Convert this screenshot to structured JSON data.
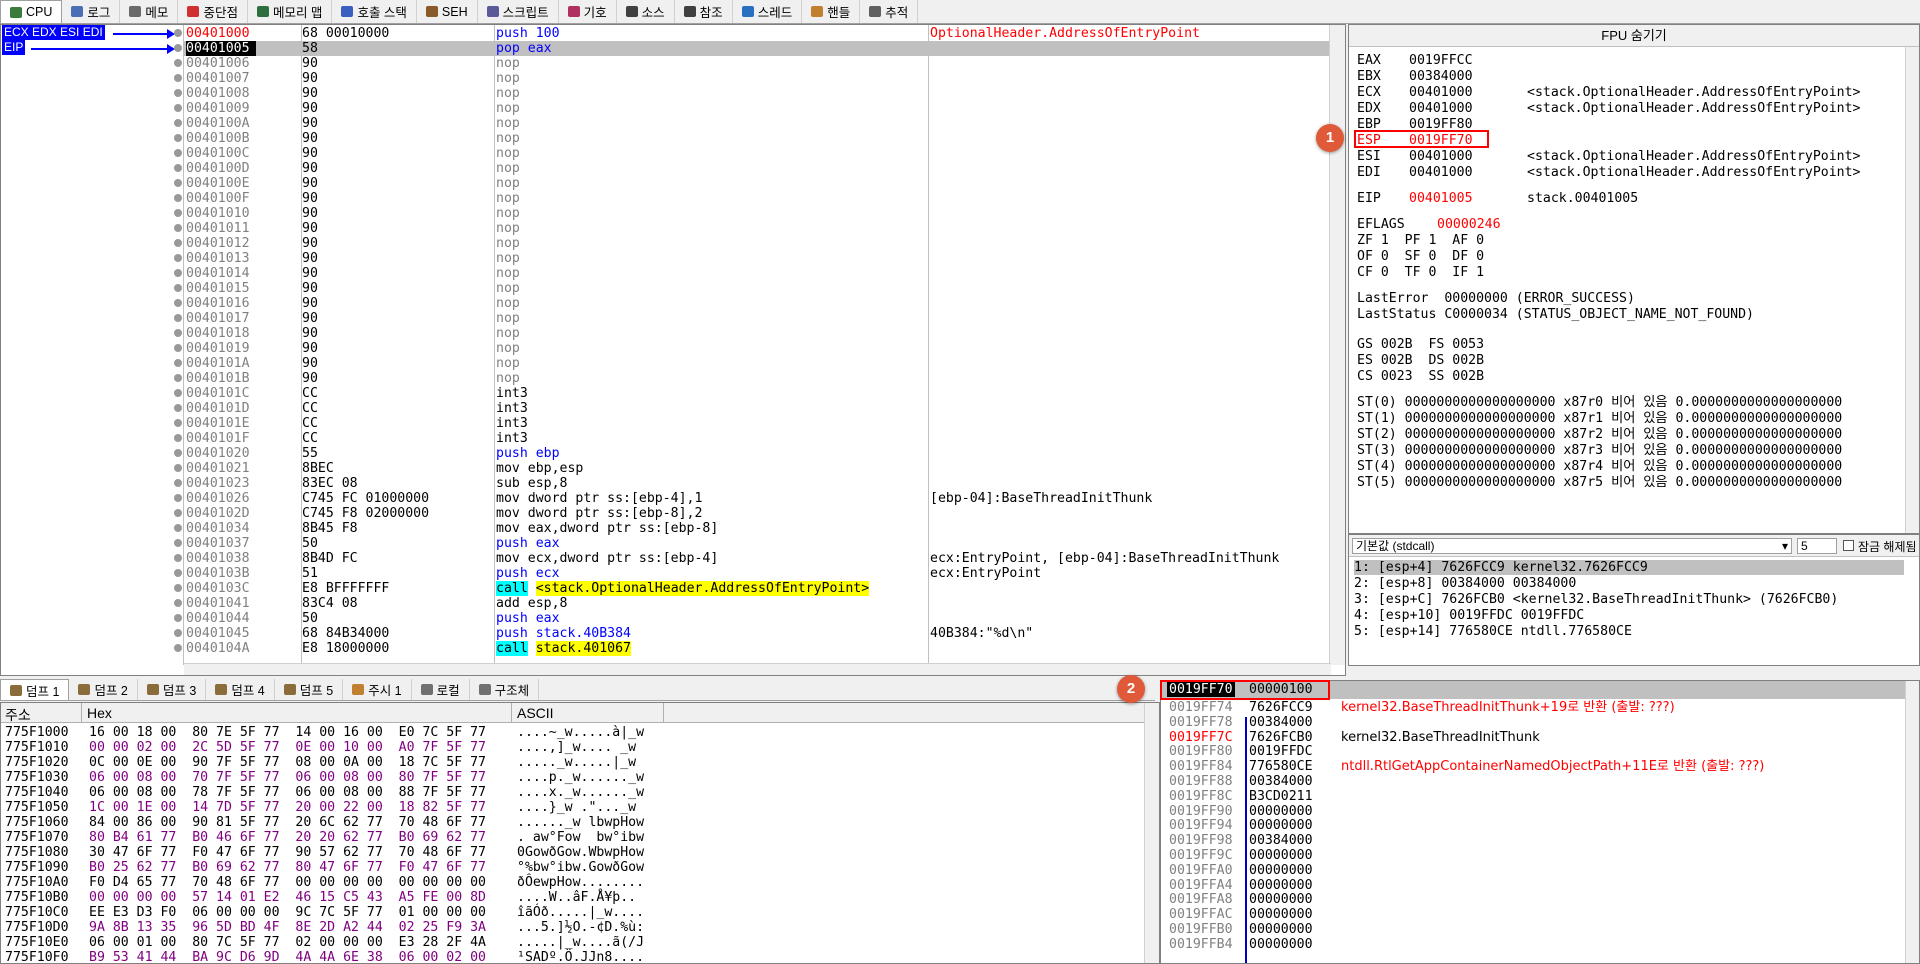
{
  "tabs": [
    {
      "label": "CPU",
      "icon": "cpu-icon",
      "color": "#3a7d3a"
    },
    {
      "label": "로그",
      "icon": "log-icon",
      "color": "#4a6fb5"
    },
    {
      "label": "메모",
      "icon": "note-icon",
      "color": "#6a6a6a"
    },
    {
      "label": "중단점",
      "icon": "breakpoint-icon",
      "color": "#d03030"
    },
    {
      "label": "메모리 맵",
      "icon": "memory-map-icon",
      "color": "#2f6f3f"
    },
    {
      "label": "호출 스택",
      "icon": "call-stack-icon",
      "color": "#3a5fbf"
    },
    {
      "label": "SEH",
      "icon": "seh-icon",
      "color": "#8a5a2a"
    },
    {
      "label": "스크립트",
      "icon": "script-icon",
      "color": "#5a5a9a"
    },
    {
      "label": "기호",
      "icon": "symbol-icon",
      "color": "#b03060"
    },
    {
      "label": "소스",
      "icon": "source-icon",
      "color": "#404040"
    },
    {
      "label": "참조",
      "icon": "reference-icon",
      "color": "#404040"
    },
    {
      "label": "스레드",
      "icon": "thread-icon",
      "color": "#2a70c0"
    },
    {
      "label": "핸들",
      "icon": "handle-icon",
      "color": "#c08030"
    },
    {
      "label": "추적",
      "icon": "trace-icon",
      "color": "#606060"
    }
  ],
  "disasm": {
    "reg_labels": [
      "ECX EDX ESI EDI",
      "EIP"
    ],
    "rows": [
      {
        "addr": "00401000",
        "bytes": "68 00010000",
        "asm": "push 100",
        "cmt": "OptionalHeader.AddressOfEntryPoint",
        "cls": "push",
        "addrred": true,
        "cmtred": true
      },
      {
        "addr": "00401005",
        "bytes": "58",
        "asm": "pop eax",
        "cmt": "",
        "cls": "push",
        "sel": true
      },
      {
        "addr": "00401006",
        "bytes": "90",
        "asm": "nop",
        "cmt": "",
        "cls": "nop"
      },
      {
        "addr": "00401007",
        "bytes": "90",
        "asm": "nop",
        "cmt": "",
        "cls": "nop"
      },
      {
        "addr": "00401008",
        "bytes": "90",
        "asm": "nop",
        "cmt": "",
        "cls": "nop"
      },
      {
        "addr": "00401009",
        "bytes": "90",
        "asm": "nop",
        "cmt": "",
        "cls": "nop"
      },
      {
        "addr": "0040100A",
        "bytes": "90",
        "asm": "nop",
        "cmt": "",
        "cls": "nop"
      },
      {
        "addr": "0040100B",
        "bytes": "90",
        "asm": "nop",
        "cmt": "",
        "cls": "nop"
      },
      {
        "addr": "0040100C",
        "bytes": "90",
        "asm": "nop",
        "cmt": "",
        "cls": "nop"
      },
      {
        "addr": "0040100D",
        "bytes": "90",
        "asm": "nop",
        "cmt": "",
        "cls": "nop"
      },
      {
        "addr": "0040100E",
        "bytes": "90",
        "asm": "nop",
        "cmt": "",
        "cls": "nop"
      },
      {
        "addr": "0040100F",
        "bytes": "90",
        "asm": "nop",
        "cmt": "",
        "cls": "nop"
      },
      {
        "addr": "00401010",
        "bytes": "90",
        "asm": "nop",
        "cmt": "",
        "cls": "nop"
      },
      {
        "addr": "00401011",
        "bytes": "90",
        "asm": "nop",
        "cmt": "",
        "cls": "nop"
      },
      {
        "addr": "00401012",
        "bytes": "90",
        "asm": "nop",
        "cmt": "",
        "cls": "nop"
      },
      {
        "addr": "00401013",
        "bytes": "90",
        "asm": "nop",
        "cmt": "",
        "cls": "nop"
      },
      {
        "addr": "00401014",
        "bytes": "90",
        "asm": "nop",
        "cmt": "",
        "cls": "nop"
      },
      {
        "addr": "00401015",
        "bytes": "90",
        "asm": "nop",
        "cmt": "",
        "cls": "nop"
      },
      {
        "addr": "00401016",
        "bytes": "90",
        "asm": "nop",
        "cmt": "",
        "cls": "nop"
      },
      {
        "addr": "00401017",
        "bytes": "90",
        "asm": "nop",
        "cmt": "",
        "cls": "nop"
      },
      {
        "addr": "00401018",
        "bytes": "90",
        "asm": "nop",
        "cmt": "",
        "cls": "nop"
      },
      {
        "addr": "00401019",
        "bytes": "90",
        "asm": "nop",
        "cmt": "",
        "cls": "nop"
      },
      {
        "addr": "0040101A",
        "bytes": "90",
        "asm": "nop",
        "cmt": "",
        "cls": "nop"
      },
      {
        "addr": "0040101B",
        "bytes": "90",
        "asm": "nop",
        "cmt": "",
        "cls": "nop"
      },
      {
        "addr": "0040101C",
        "bytes": "CC",
        "asm": "int3",
        "cmt": "",
        "cls": "int"
      },
      {
        "addr": "0040101D",
        "bytes": "CC",
        "asm": "int3",
        "cmt": "",
        "cls": "int"
      },
      {
        "addr": "0040101E",
        "bytes": "CC",
        "asm": "int3",
        "cmt": "",
        "cls": "int"
      },
      {
        "addr": "0040101F",
        "bytes": "CC",
        "asm": "int3",
        "cmt": "",
        "cls": "int"
      },
      {
        "addr": "00401020",
        "bytes": "55",
        "asm": "push ebp",
        "cmt": "",
        "cls": "push"
      },
      {
        "addr": "00401021",
        "bytes": "8BEC",
        "asm": "mov ebp,esp",
        "cmt": "",
        "cls": "plain"
      },
      {
        "addr": "00401023",
        "bytes": "83EC 08",
        "asm": "sub esp,8",
        "cmt": "",
        "cls": "plain"
      },
      {
        "addr": "00401026",
        "bytes": "C745 FC 01000000",
        "asm": "mov dword ptr ss:[ebp-4],1",
        "cmt": "[ebp-04]:BaseThreadInitThunk",
        "cls": "plain"
      },
      {
        "addr": "0040102D",
        "bytes": "C745 F8 02000000",
        "asm": "mov dword ptr ss:[ebp-8],2",
        "cmt": "",
        "cls": "plain"
      },
      {
        "addr": "00401034",
        "bytes": "8B45 F8",
        "asm": "mov eax,dword ptr ss:[ebp-8]",
        "cmt": "",
        "cls": "plain"
      },
      {
        "addr": "00401037",
        "bytes": "50",
        "asm": "push eax",
        "cmt": "",
        "cls": "push"
      },
      {
        "addr": "00401038",
        "bytes": "8B4D FC",
        "asm": "mov ecx,dword ptr ss:[ebp-4]",
        "cmt": "ecx:EntryPoint, [ebp-04]:BaseThreadInitThunk",
        "cls": "plain"
      },
      {
        "addr": "0040103B",
        "bytes": "51",
        "asm": "push ecx",
        "cmt": "ecx:EntryPoint",
        "cls": "push"
      },
      {
        "addr": "0040103C",
        "bytes": "E8 BFFFFFFF",
        "asm": "call <stack.OptionalHeader.AddressOfEntryPoint>",
        "cmt": "",
        "cls": "call"
      },
      {
        "addr": "00401041",
        "bytes": "83C4 08",
        "asm": "add esp,8",
        "cmt": "",
        "cls": "plain"
      },
      {
        "addr": "00401044",
        "bytes": "50",
        "asm": "push eax",
        "cmt": "",
        "cls": "push"
      },
      {
        "addr": "00401045",
        "bytes": "68 84B34000",
        "asm": "push stack.40B384",
        "cmt": "40B384:\"%d\\n\"",
        "cls": "push"
      },
      {
        "addr": "0040104A",
        "bytes": "E8 18000000",
        "asm": "call stack.401067",
        "cmt": "",
        "cls": "call"
      }
    ]
  },
  "regs": {
    "title": "FPU 숨기기",
    "lines": [
      {
        "n": "EAX",
        "v": "0019FFCC",
        "c": ""
      },
      {
        "n": "EBX",
        "v": "00384000",
        "c": ""
      },
      {
        "n": "ECX",
        "v": "00401000",
        "c": "<stack.OptionalHeader.AddressOfEntryPoint>"
      },
      {
        "n": "EDX",
        "v": "00401000",
        "c": "<stack.OptionalHeader.AddressOfEntryPoint>"
      },
      {
        "n": "EBP",
        "v": "0019FF80",
        "c": ""
      },
      {
        "n": "ESP",
        "v": "0019FF70",
        "c": "",
        "red": true
      },
      {
        "n": "ESI",
        "v": "00401000",
        "c": "<stack.OptionalHeader.AddressOfEntryPoint>"
      },
      {
        "n": "EDI",
        "v": "00401000",
        "c": "<stack.OptionalHeader.AddressOfEntryPoint>"
      }
    ],
    "eip": {
      "n": "EIP",
      "v": "00401005",
      "c": "stack.00401005"
    },
    "eflags": {
      "n": "EFLAGS",
      "v": "00000246"
    },
    "flags": [
      "ZF 1  PF 1  AF 0",
      "OF 0  SF 0  DF 0",
      "CF 0  TF 0  IF 1"
    ],
    "lasterror": "LastError  00000000 (ERROR_SUCCESS)",
    "laststatus": "LastStatus C0000034 (STATUS_OBJECT_NAME_NOT_FOUND)",
    "segs": [
      "GS 002B  FS 0053",
      "ES 002B  DS 002B",
      "CS 0023  SS 002B"
    ],
    "st": [
      "ST(0) 0000000000000000000 x87r0 비어 있음 0.0000000000000000000",
      "ST(1) 0000000000000000000 x87r1 비어 있음 0.0000000000000000000",
      "ST(2) 0000000000000000000 x87r2 비어 있음 0.0000000000000000000",
      "ST(3) 0000000000000000000 x87r3 비어 있음 0.0000000000000000000",
      "ST(4) 0000000000000000000 x87r4 비어 있음 0.0000000000000000000",
      "ST(5) 0000000000000000000 x87r5 비어 있음 0.0000000000000000000"
    ]
  },
  "callstack": {
    "conv": "기본값 (stdcall)",
    "count": "5",
    "lock_label": "잠금 해제됨",
    "lines": [
      "1: [esp+4] 7626FCC9 kernel32.7626FCC9",
      "2: [esp+8] 00384000 00384000",
      "3: [esp+C] 7626FCB0 <kernel32.BaseThreadInitThunk> (7626FCB0)",
      "4: [esp+10] 0019FFDC 0019FFDC",
      "5: [esp+14] 776580CE ntdll.776580CE"
    ]
  },
  "btabs": [
    {
      "label": "덤프 1",
      "icon": "dump-icon"
    },
    {
      "label": "덤프 2",
      "icon": "dump-icon"
    },
    {
      "label": "덤프 3",
      "icon": "dump-icon"
    },
    {
      "label": "덤프 4",
      "icon": "dump-icon"
    },
    {
      "label": "덤프 5",
      "icon": "dump-icon"
    },
    {
      "label": "주시 1",
      "icon": "watch-icon"
    },
    {
      "label": "로컬",
      "icon": "locals-icon"
    },
    {
      "label": "구조체",
      "icon": "struct-icon"
    }
  ],
  "dump": {
    "h_addr": "주소",
    "h_hex": "Hex",
    "h_ascii": "ASCII",
    "rows": [
      {
        "a": "775F1000",
        "h": "16 00 18 00  80 7E 5F 77  14 00 16 00  E0 7C 5F 77",
        "s": "....~_w.....à|_w"
      },
      {
        "a": "775F1010",
        "h": "00 00 02 00  2C 5D 5F 77  0E 00 10 00  A0 7F 5F 77",
        "s": "....,]_w.... _w"
      },
      {
        "a": "775F1020",
        "h": "0C 00 0E 00  90 7F 5F 77  08 00 0A 00  18 7C 5F 77",
        "s": "....._w.....|_w"
      },
      {
        "a": "775F1030",
        "h": "06 00 08 00  70 7F 5F 77  06 00 08 00  80 7F 5F 77",
        "s": "....p._w......_w"
      },
      {
        "a": "775F1040",
        "h": "06 00 08 00  78 7F 5F 77  06 00 08 00  88 7F 5F 77",
        "s": "....x._w......_w"
      },
      {
        "a": "775F1050",
        "h": "1C 00 1E 00  14 7D 5F 77  20 00 22 00  18 82 5F 77",
        "s": "....}_w .\"..._w"
      },
      {
        "a": "775F1060",
        "h": "84 00 86 00  90 81 5F 77  20 6C 62 77  70 48 6F 77",
        "s": "......_w lbwpHow"
      },
      {
        "a": "775F1070",
        "h": "80 B4 61 77  B0 46 6F 77  20 20 62 77  B0 69 62 77",
        "s": ". aw°Fow  bw°ibw"
      },
      {
        "a": "775F1080",
        "h": "30 47 6F 77  F0 47 6F 77  90 57 62 77  70 48 6F 77",
        "s": "0GowðGow.WbwpHow"
      },
      {
        "a": "775F1090",
        "h": "B0 25 62 77  B0 69 62 77  80 47 6F 77  F0 47 6F 77",
        "s": "°%bw°ibw.GowðGow"
      },
      {
        "a": "775F10A0",
        "h": "F0 D4 65 77  70 48 6F 77  00 00 00 00  00 00 00 00",
        "s": "ðÔewpHow........"
      },
      {
        "a": "775F10B0",
        "h": "00 00 00 00  57 14 01 E2  46 15 C5 43  A5 FE 00 8D",
        "s": "....W..âF.Å¥þ.."
      },
      {
        "a": "775F10C0",
        "h": "EE E3 D3 F0  06 00 00 00  9C 7C 5F 77  01 00 00 00",
        "s": "îãÓð.....|_w...."
      },
      {
        "a": "775F10D0",
        "h": "9A 8B 13 35  96 5D BD 4F  8E 2D A2 44  02 25 F9 3A",
        "s": "...5.]½O.-¢D.%ù:"
      },
      {
        "a": "775F10E0",
        "h": "06 00 01 00  80 7C 5F 77  02 00 00 00  E3 28 2F 4A",
        "s": ".....|_w....ã(/J"
      },
      {
        "a": "775F10F0",
        "h": "B9 53 41 44  BA 9C D6 9D  4A 4A 6E 38  06 00 02 00",
        "s": "¹SADº.Ö.JJn8...."
      }
    ]
  },
  "stack": {
    "top_addr": "0019FF70",
    "top_val": "00000100",
    "rows": [
      {
        "a": "0019FF74",
        "v": "7626FCC9",
        "c": "kernel32.BaseThreadInitThunk+19로 반환 (출발: ???)",
        "cred": true
      },
      {
        "a": "0019FF78",
        "v": "00384000",
        "c": ""
      },
      {
        "a": "0019FF7C",
        "v": "7626FCB0",
        "c": "kernel32.BaseThreadInitThunk",
        "ared": true
      },
      {
        "a": "0019FF80",
        "v": "0019FFDC",
        "c": ""
      },
      {
        "a": "0019FF84",
        "v": "776580CE",
        "c": "ntdll.RtlGetAppContainerNamedObjectPath+11E로 반환 (출발: ???)",
        "cred": true
      },
      {
        "a": "0019FF88",
        "v": "00384000",
        "c": ""
      },
      {
        "a": "0019FF8C",
        "v": "B3CD0211",
        "c": ""
      },
      {
        "a": "0019FF90",
        "v": "00000000",
        "c": ""
      },
      {
        "a": "0019FF94",
        "v": "00000000",
        "c": ""
      },
      {
        "a": "0019FF98",
        "v": "00384000",
        "c": ""
      },
      {
        "a": "0019FF9C",
        "v": "00000000",
        "c": ""
      },
      {
        "a": "0019FFA0",
        "v": "00000000",
        "c": ""
      },
      {
        "a": "0019FFA4",
        "v": "00000000",
        "c": ""
      },
      {
        "a": "0019FFA8",
        "v": "00000000",
        "c": ""
      },
      {
        "a": "0019FFAC",
        "v": "00000000",
        "c": ""
      },
      {
        "a": "0019FFB0",
        "v": "00000000",
        "c": ""
      },
      {
        "a": "0019FFB4",
        "v": "00000000",
        "c": ""
      }
    ]
  },
  "annotations": [
    "1",
    "2"
  ]
}
